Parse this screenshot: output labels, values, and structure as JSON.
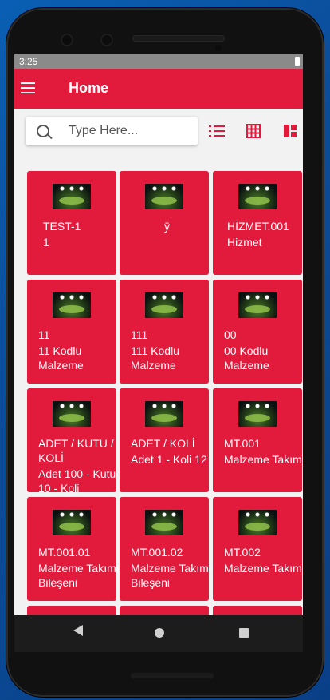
{
  "status_bar": {
    "time": "3:25"
  },
  "app_bar": {
    "title": "Home"
  },
  "search": {
    "placeholder": "Type Here...",
    "value": ""
  },
  "toolbar": {
    "icons": [
      "list-icon",
      "grid-icon",
      "dashboard-icon"
    ],
    "accent": "#e21a3c"
  },
  "cards": [
    {
      "line1": "TEST-1",
      "line2": "1"
    },
    {
      "line1": "ÿ",
      "line2": ""
    },
    {
      "line1": "HİZMET.001",
      "line2": "Hizmet"
    },
    {
      "line1": "11",
      "line2": "11 Kodlu Malzeme"
    },
    {
      "line1": "111",
      "line2": "111 Kodlu Malzeme"
    },
    {
      "line1": "00",
      "line2": "00 Kodlu Malzeme"
    },
    {
      "line1": "ADET / KUTU / KOLİ",
      "line2": "Adet 100 - Kutu 10 - Koli"
    },
    {
      "line1": "ADET / KOLİ",
      "line2": "Adet 1 - Koli 12"
    },
    {
      "line1": "MT.001",
      "line2": "Malzeme Takımı"
    },
    {
      "line1": "MT.001.01",
      "line2": "Malzeme Takımı Bileşeni"
    },
    {
      "line1": "MT.001.02",
      "line2": "Malzeme Takımı Bileşeni"
    },
    {
      "line1": "MT.002",
      "line2": "Malzeme Takımı"
    }
  ],
  "nav_bar": {
    "icons": [
      "back-icon",
      "home-icon",
      "recent-apps-icon"
    ]
  }
}
